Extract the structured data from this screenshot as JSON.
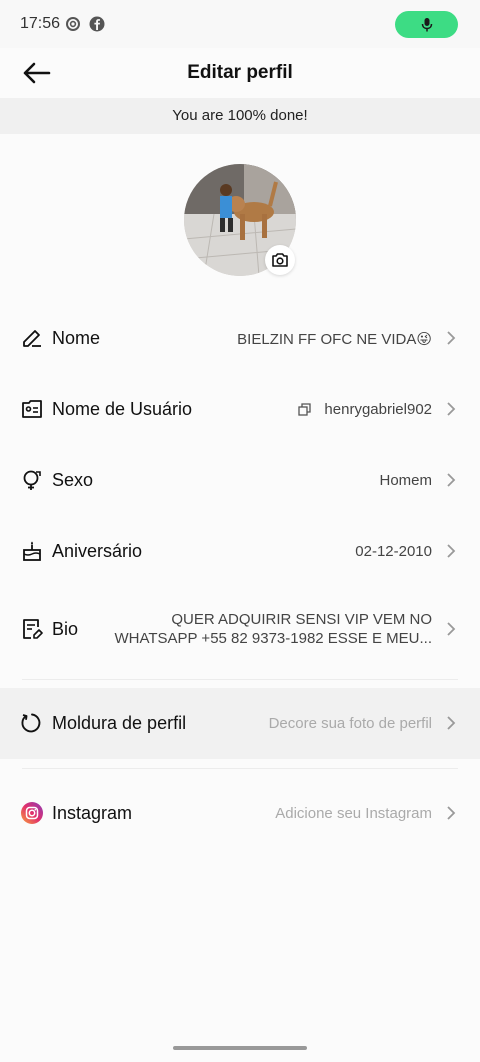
{
  "status": {
    "time": "17:56"
  },
  "header": {
    "title": "Editar perfil"
  },
  "progress": {
    "text": "You are 100% done!"
  },
  "fields": {
    "nome": {
      "label": "Nome",
      "value": "BIELZIN FF OFC NE VIDA😜"
    },
    "usuario": {
      "label": "Nome de Usuário",
      "value": "henrygabriel902"
    },
    "sexo": {
      "label": "Sexo",
      "value": "Homem"
    },
    "aniversario": {
      "label": "Aniversário",
      "value": "02-12-2010"
    },
    "bio": {
      "label": "Bio",
      "value": "QUER ADQUIRIR SENSI VIP VEM NO WHATSAPP +55 82 9373-1982 ESSE E MEU..."
    },
    "moldura": {
      "label": "Moldura de perfil",
      "value": "Decore sua foto de perfil"
    },
    "instagram": {
      "label": "Instagram",
      "value": "Adicione seu Instagram"
    }
  },
  "colors": {
    "mic_pill": "#3ddc84",
    "highlight_row": "#f1f1f1"
  }
}
